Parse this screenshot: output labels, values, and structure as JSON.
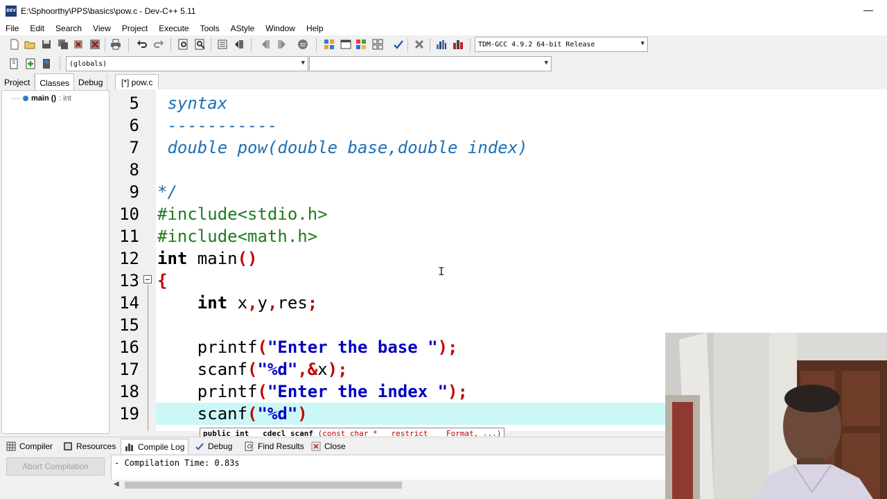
{
  "window": {
    "title": "E:\\Sphoorthy\\PPS\\basics\\pow.c - Dev-C++ 5.11",
    "app_icon_text": "DEV",
    "minimize_glyph": "—"
  },
  "menu": [
    "File",
    "Edit",
    "Search",
    "View",
    "Project",
    "Execute",
    "Tools",
    "AStyle",
    "Window",
    "Help"
  ],
  "toolbar": {
    "compiler_select": "TDM-GCC 4.9.2 64-bit Release",
    "scope_select": "(globals)",
    "member_select": ""
  },
  "left_panel": {
    "tabs": [
      "Project",
      "Classes",
      "Debug"
    ],
    "active_tab": "Classes",
    "tree": {
      "name": "main ()",
      "type": ": int"
    }
  },
  "editor": {
    "tab_label": "[*] pow.c",
    "current_line": 19,
    "lines": [
      {
        "n": "5",
        "text": " syntax"
      },
      {
        "n": "6",
        "text": " -----------"
      },
      {
        "n": "7",
        "text": " double pow(double base,double index)"
      },
      {
        "n": "8",
        "text": ""
      },
      {
        "n": "9",
        "text": "*/"
      },
      {
        "n": "10",
        "text": "#include<stdio.h>"
      },
      {
        "n": "11",
        "text": "#include<math.h>"
      },
      {
        "n": "12",
        "text": "int main()"
      },
      {
        "n": "13",
        "text": "{"
      },
      {
        "n": "14",
        "text": "    int x,y,res;"
      },
      {
        "n": "15",
        "text": ""
      },
      {
        "n": "16",
        "text": "    printf(\"Enter the base \");"
      },
      {
        "n": "17",
        "text": "    scanf(\"%d\",&x);"
      },
      {
        "n": "18",
        "text": "    printf(\"Enter the index \");"
      },
      {
        "n": "19",
        "text": "    scanf(\"%d\")"
      }
    ],
    "hint": {
      "prefix": "public int __cdecl scanf ",
      "args": "(const char * __restrict__ _Format, ...)"
    }
  },
  "bottom": {
    "tabs": [
      {
        "label": "Compiler",
        "icon": "grid-icon"
      },
      {
        "label": "Resources",
        "icon": "resources-icon"
      },
      {
        "label": "Compile Log",
        "icon": "chart-icon"
      },
      {
        "label": "Debug",
        "icon": "check-icon"
      },
      {
        "label": "Find Results",
        "icon": "find-icon"
      },
      {
        "label": "Close",
        "icon": "close-icon"
      }
    ],
    "active_tab": "Compile Log",
    "abort_button": "Abort Compilation",
    "log_text": "- Compilation Time: 0.83s"
  },
  "colors": {
    "comment": "#1f6fb2",
    "preprocessor": "#1e7a1e",
    "symbol": "#c00000",
    "string": "#0000c0",
    "current_line_bg": "#ccf7f7"
  }
}
